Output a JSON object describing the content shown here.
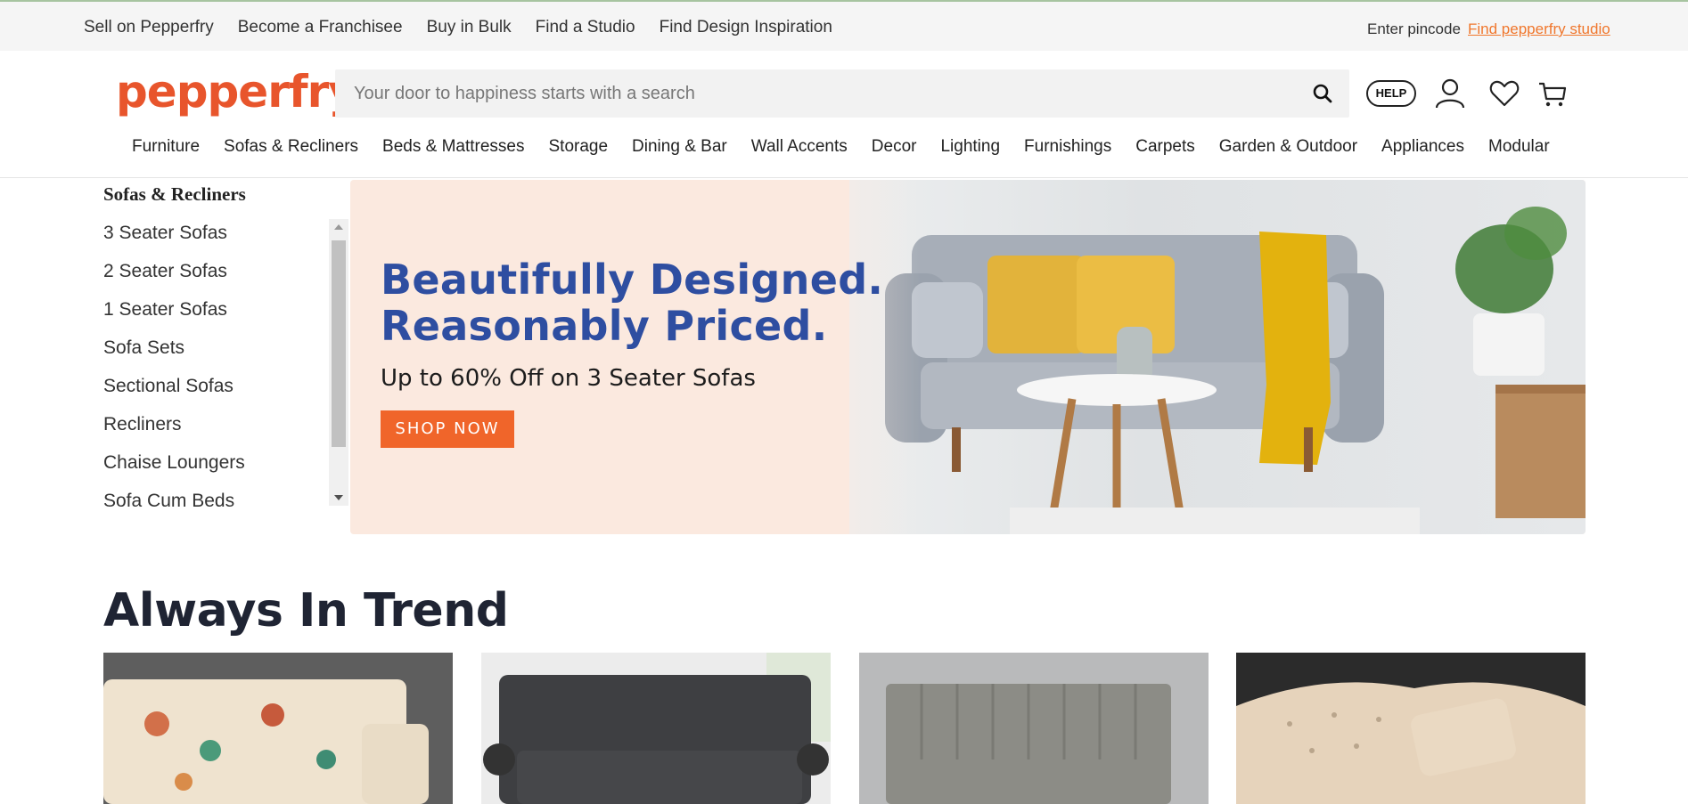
{
  "topbar": {
    "links": [
      "Sell on Pepperfry",
      "Become a Franchisee",
      "Buy in Bulk",
      "Find a Studio",
      "Find Design Inspiration"
    ],
    "pincode_label": "Enter pincode",
    "studio_link": "Find pepperfry studio"
  },
  "header": {
    "logo": "pepperfry",
    "search_placeholder": "Your door to happiness starts with a search",
    "help_label": "HELP",
    "icons": [
      "search-icon",
      "user-icon",
      "heart-icon",
      "cart-icon"
    ]
  },
  "nav": {
    "categories": [
      "Furniture",
      "Sofas & Recliners",
      "Beds & Mattresses",
      "Storage",
      "Dining & Bar",
      "Wall Accents",
      "Decor",
      "Lighting",
      "Furnishings",
      "Carpets",
      "Garden & Outdoor",
      "Appliances",
      "Modular"
    ]
  },
  "sidebar": {
    "title": "Sofas & Recliners",
    "items": [
      "3 Seater Sofas",
      "2 Seater Sofas",
      "1 Seater Sofas",
      "Sofa Sets",
      "Sectional Sofas",
      "Recliners",
      "Chaise Loungers",
      "Sofa Cum Beds"
    ]
  },
  "hero": {
    "headline_line1": "Beautifully Designed.",
    "headline_line2": "Reasonably Priced.",
    "subtext": "Up to 60% Off on 3 Seater Sofas",
    "cta": "SHOP NOW"
  },
  "section": {
    "title": "Always In Trend"
  },
  "colors": {
    "brand": "#e8552c",
    "hero_headline": "#2e4ea1",
    "cta": "#f0652a",
    "hero_bg": "#fbe9df"
  }
}
